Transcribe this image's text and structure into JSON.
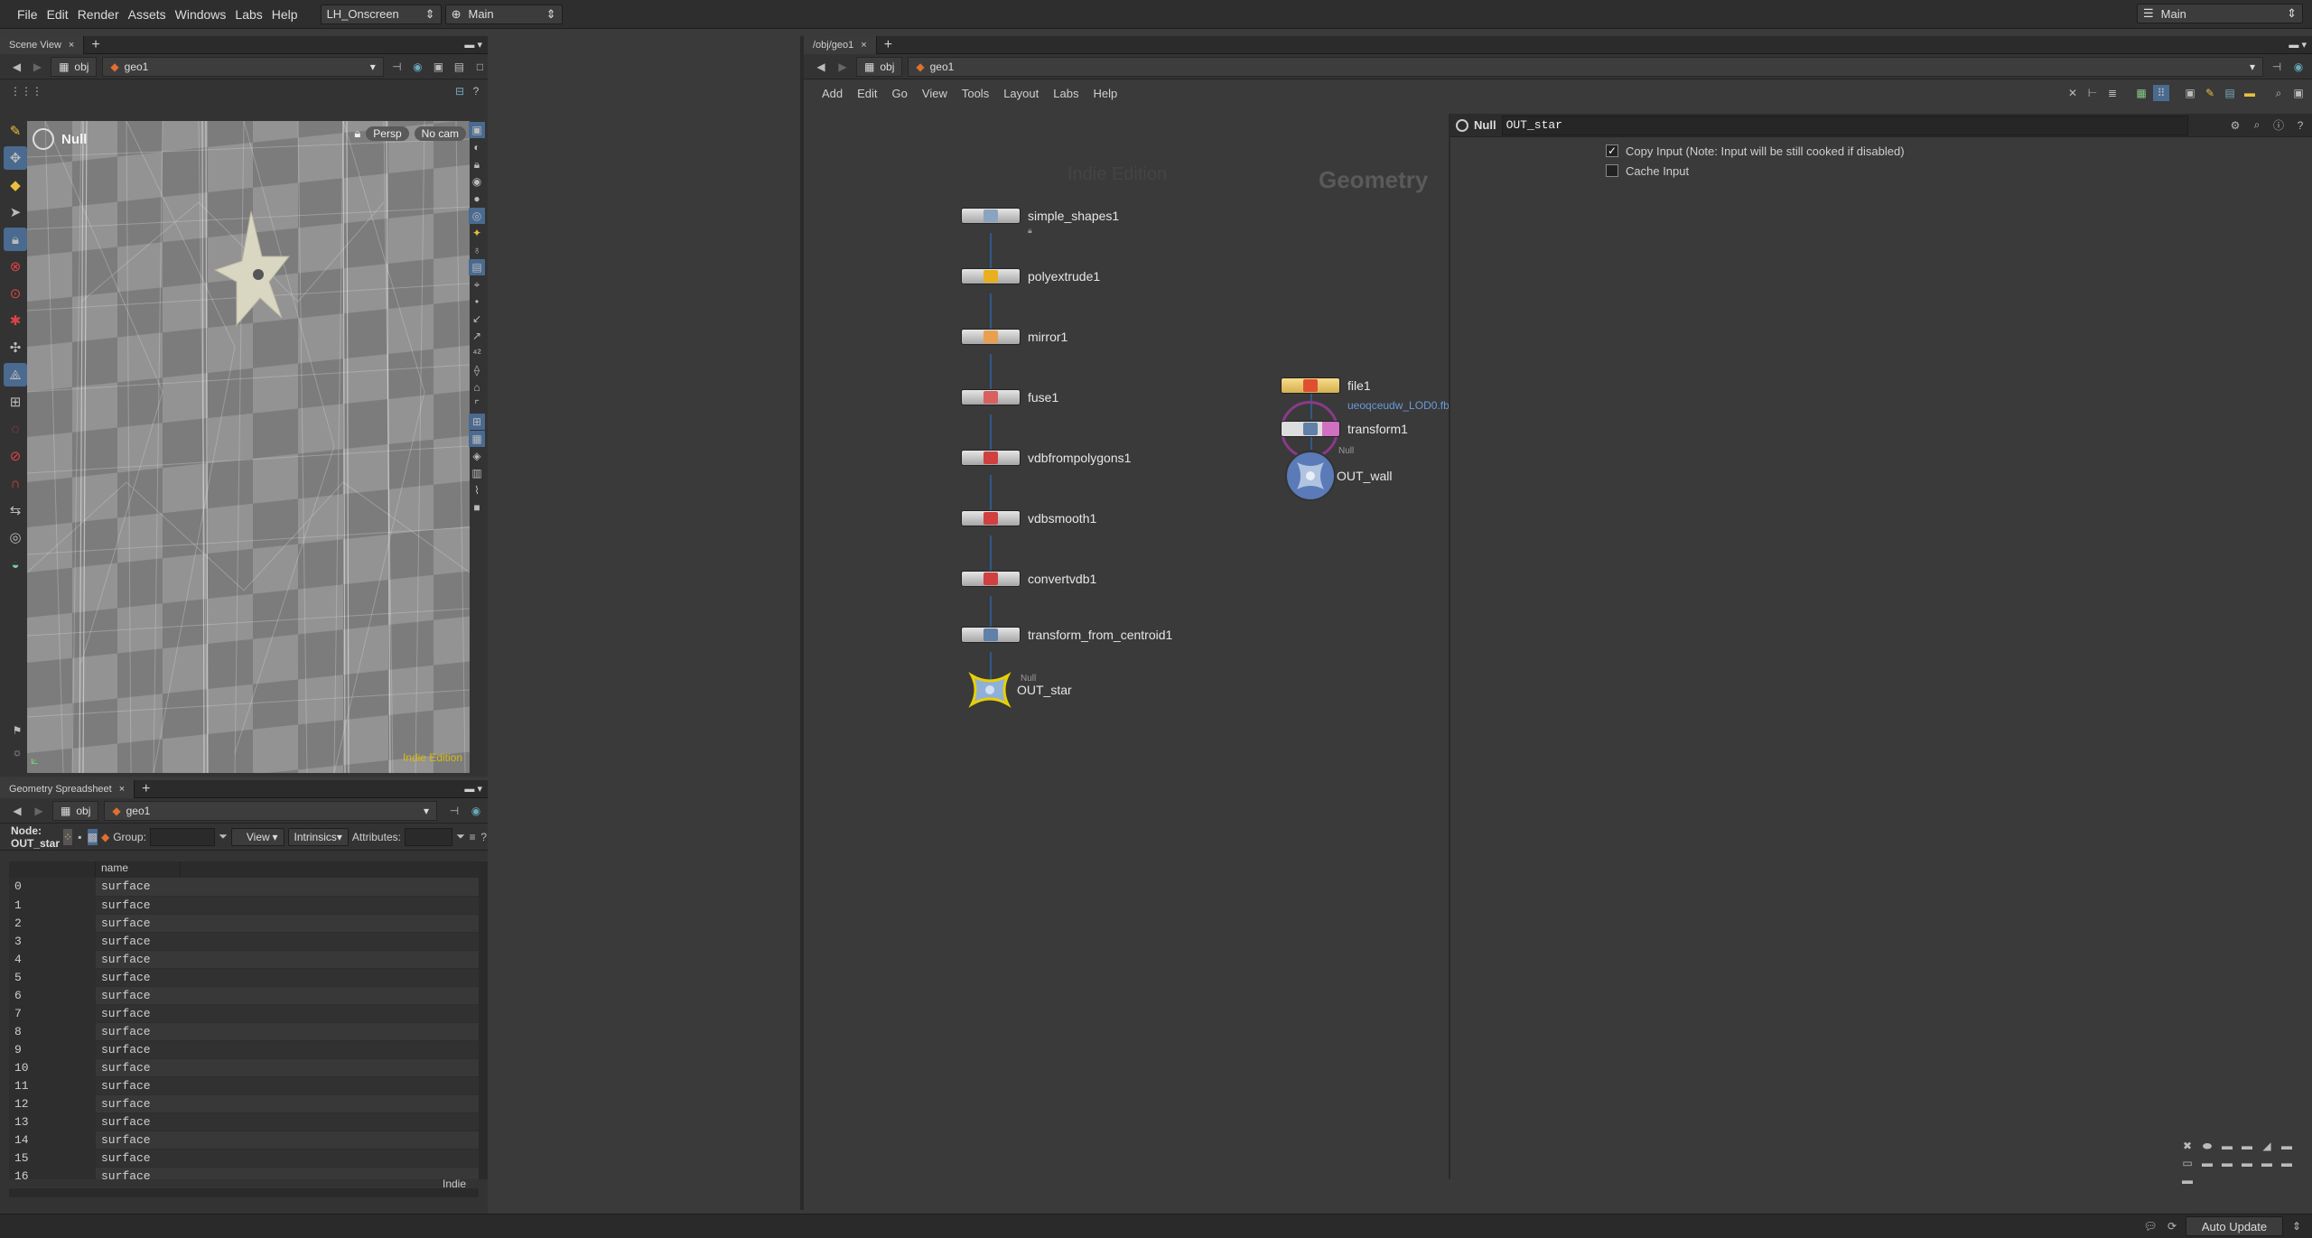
{
  "menubar": {
    "items": [
      "File",
      "Edit",
      "Render",
      "Assets",
      "Windows",
      "Labs",
      "Help"
    ],
    "desktop": "LH_Onscreen",
    "context": "Main",
    "right_desktop": "Main"
  },
  "scene_view": {
    "tab": "Scene View",
    "path_obj": "obj",
    "path_geo": "geo1",
    "node_label": "Null",
    "persp": "Persp",
    "cam": "No cam",
    "watermark": "Indie Edition"
  },
  "network": {
    "tab": "/obj/geo1",
    "path_obj": "obj",
    "path_geo": "geo1",
    "menu": [
      "Add",
      "Edit",
      "Go",
      "View",
      "Tools",
      "Layout",
      "Labs",
      "Help"
    ],
    "watermark_edition": "Indie Edition",
    "watermark_type": "Geometry",
    "nodes": [
      "simple_shapes1",
      "polyextrude1",
      "mirror1",
      "fuse1",
      "vdbfrompolygons1",
      "vdbsmooth1",
      "convertvdb1",
      "transform_from_centroid1",
      "OUT_star"
    ],
    "null_tag": "Null",
    "side_nodes": {
      "file": "file1",
      "file_path": "ueoqceudw_LOD0.fbx",
      "transform": "transform1",
      "out": "OUT_wall",
      "null_tag": "Null"
    }
  },
  "params": {
    "type": "Null",
    "name": "OUT_star",
    "copy_input": "Copy Input (Note: Input will be still cooked if disabled)",
    "cache_input": "Cache Input"
  },
  "spreadsheet": {
    "tab": "Geometry Spreadsheet",
    "path_obj": "obj",
    "path_geo": "geo1",
    "node_label": "Node: OUT_star",
    "group_label": "Group:",
    "view": "View",
    "intrinsics": "Intrinsics",
    "attributes": "Attributes:",
    "col_name": "name",
    "rows": [
      "0",
      "1",
      "2",
      "3",
      "4",
      "5",
      "6",
      "7",
      "8",
      "9",
      "10",
      "11",
      "12",
      "13",
      "14",
      "15",
      "16"
    ],
    "value": "surface",
    "footer": "Indie"
  },
  "status": {
    "auto_update": "Auto Update"
  },
  "colors": {
    "wire": "#2f5a86",
    "watermark": "#c9b300",
    "selected_node": "#e8d000"
  }
}
